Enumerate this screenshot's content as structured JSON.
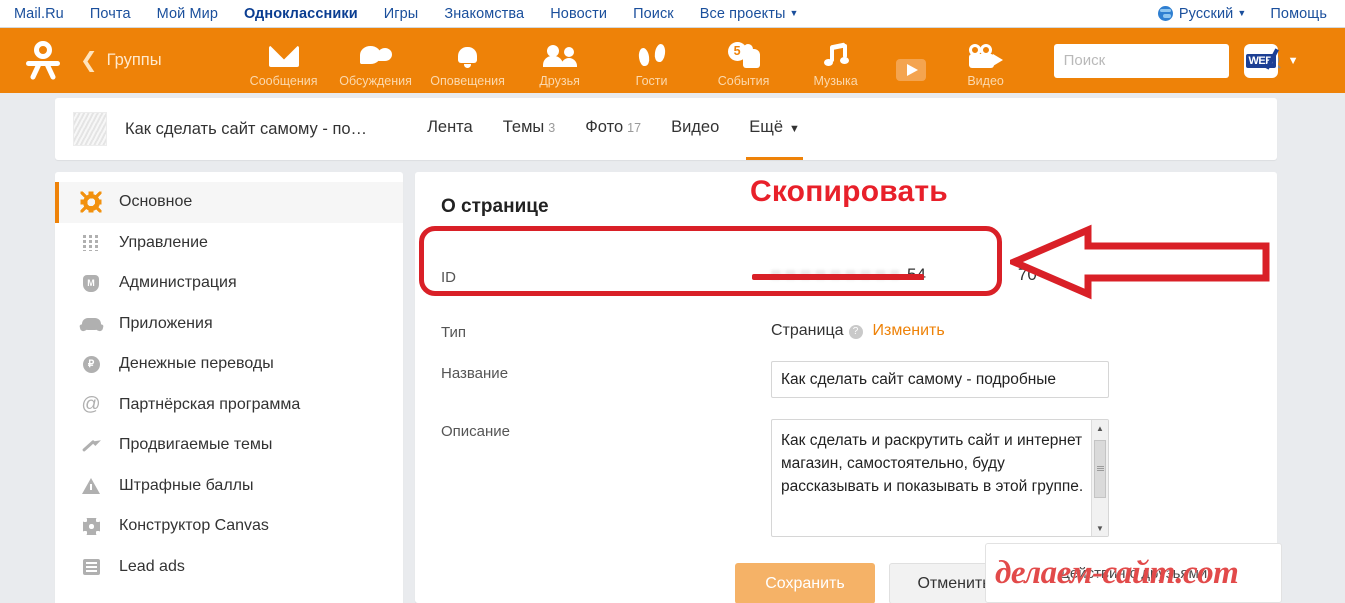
{
  "mailru_bar": {
    "links": [
      "Mail.Ru",
      "Почта",
      "Мой Мир",
      "Одноклассники",
      "Игры",
      "Знакомства",
      "Новости",
      "Поиск",
      "Все проекты"
    ],
    "active_link": "Одноклассники",
    "all_projects_caret": "▼",
    "language": "Русский",
    "language_caret": "▼",
    "help": "Помощь"
  },
  "ok_bar": {
    "back_chevron": "❮",
    "back_label": "Группы",
    "nav": [
      {
        "label": "Сообщения",
        "icon": "envelope-icon"
      },
      {
        "label": "Обсуждения",
        "icon": "chat-bubbles-icon"
      },
      {
        "label": "Оповещения",
        "icon": "bell-icon"
      },
      {
        "label": "Друзья",
        "icon": "friends-icon"
      },
      {
        "label": "Гости",
        "icon": "footsteps-icon"
      },
      {
        "label": "События",
        "icon": "thumbs-up-icon",
        "badge": "5"
      },
      {
        "label": "Музыка",
        "icon": "music-note-icon"
      },
      {
        "label": "",
        "icon": "play-icon"
      },
      {
        "label": "Видео",
        "icon": "video-camera-icon"
      }
    ],
    "search_placeholder": "Поиск",
    "search_value": "",
    "web_tile_label": "WEB",
    "web_caret": "▼",
    "accent_color": "#ee8208"
  },
  "group_header": {
    "title": "Как сделать сайт самому - по…",
    "tabs": [
      {
        "label": "Лента",
        "count": "",
        "active": false
      },
      {
        "label": "Темы",
        "count": "3",
        "active": false
      },
      {
        "label": "Фото",
        "count": "17",
        "active": false
      },
      {
        "label": "Видео",
        "count": "",
        "active": false
      },
      {
        "label": "Ещё",
        "count": "",
        "caret": "▼",
        "active": true
      }
    ]
  },
  "sidebar": {
    "items": [
      {
        "label": "Основное",
        "icon": "gear-icon",
        "active": true
      },
      {
        "label": "Управление",
        "icon": "sliders-icon",
        "active": false
      },
      {
        "label": "Администрация",
        "icon": "shield-icon",
        "active": false
      },
      {
        "label": "Приложения",
        "icon": "gamepad-icon",
        "active": false
      },
      {
        "label": "Денежные переводы",
        "icon": "ruble-circle-icon",
        "active": false
      },
      {
        "label": "Партнёрская программа",
        "icon": "at-sign-icon",
        "active": false
      },
      {
        "label": "Продвигаемые темы",
        "icon": "trend-arrow-icon",
        "active": false
      },
      {
        "label": "Штрафные баллы",
        "icon": "warning-triangle-icon",
        "active": false
      },
      {
        "label": "Конструктор Canvas",
        "icon": "canvas-icon",
        "active": false
      },
      {
        "label": "Lead ads",
        "icon": "list-lines-icon",
        "active": false
      }
    ]
  },
  "content": {
    "title": "О странице",
    "id_row": {
      "label": "ID",
      "value_part1": "54",
      "value_part2": "70"
    },
    "type_row": {
      "label": "Тип",
      "value": "Страница",
      "help_glyph": "?",
      "change_link": "Изменить"
    },
    "name_row": {
      "label": "Название",
      "value": "Как сделать сайт самому - подробные"
    },
    "desc_row": {
      "label": "Описание",
      "value": "Как сделать и раскрутить сайт и интернет магазин, самостоятельно, буду рассказывать и показывать в этой группе.",
      "scroll_up": "▲",
      "scroll_down": "▼"
    },
    "save_label": "Сохранить",
    "cancel_label": "Отменить"
  },
  "right_panel": {
    "label": "Действия с друзьями"
  },
  "annotation": {
    "text": "Скопировать",
    "color": "#e8202a",
    "arrow": "left-arrow-outline"
  },
  "watermark": {
    "text": "делаем-сайт.com",
    "color": "#e24a4a"
  }
}
